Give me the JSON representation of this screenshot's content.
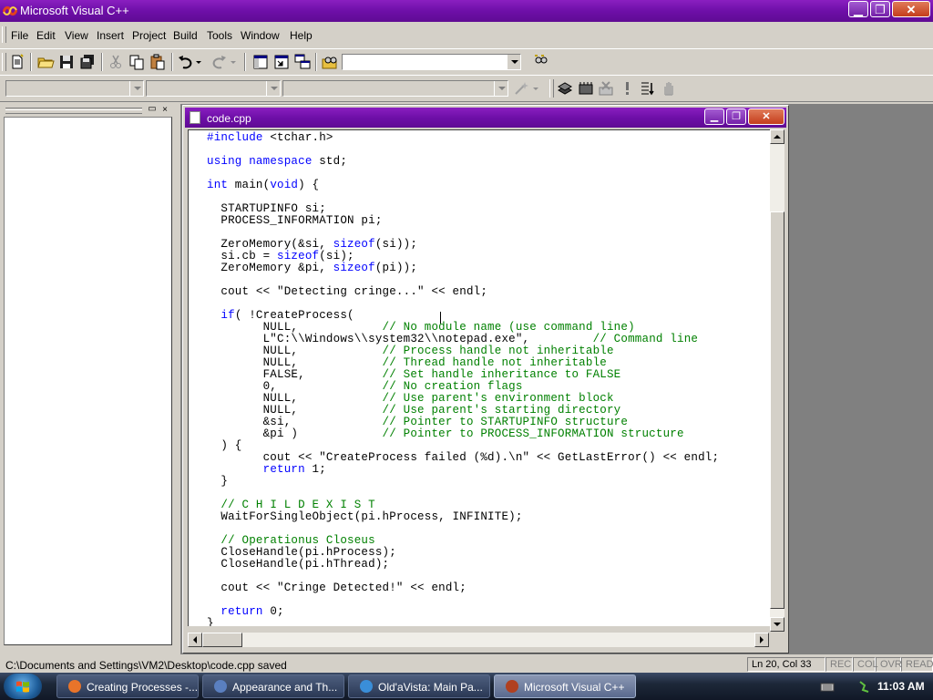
{
  "app": {
    "title": "Microsoft Visual C++"
  },
  "menu": [
    "File",
    "Edit",
    "View",
    "Insert",
    "Project",
    "Build",
    "Tools",
    "Window",
    "Help"
  ],
  "child": {
    "title": "code.cpp"
  },
  "code_lines": [
    "#include <tchar.h>",
    "",
    "using namespace std;",
    "",
    "int main(void) {",
    "",
    "  STARTUPINFO si;",
    "  PROCESS_INFORMATION pi;",
    "",
    "  ZeroMemory(&si, sizeof(si));",
    "  si.cb = sizeof(si);",
    "  ZeroMemory &pi, sizeof(pi));",
    "",
    "  cout << \"Detecting cringe...\" << endl;",
    "",
    "  if( !CreateProcess(",
    "        NULL,            // No module name (use command line)",
    "        L\"C:\\\\Windows\\\\system32\\\\notepad.exe\",         // Command line",
    "        NULL,            // Process handle not inheritable",
    "        NULL,            // Thread handle not inheritable",
    "        FALSE,           // Set handle inheritance to FALSE",
    "        0,               // No creation flags",
    "        NULL,            // Use parent's environment block",
    "        NULL,            // Use parent's starting directory",
    "        &si,             // Pointer to STARTUPINFO structure",
    "        &pi )            // Pointer to PROCESS_INFORMATION structure",
    "  ) {",
    "        cout << \"CreateProcess failed (%d).\\n\" << GetLastError() << endl;",
    "        return 1;",
    "  }",
    "",
    "  // C H I L D E X I S T",
    "  WaitForSingleObject(pi.hProcess, INFINITE);",
    "",
    "  // Operationus Closeus",
    "  CloseHandle(pi.hProcess);",
    "  CloseHandle(pi.hThread);",
    "",
    "  cout << \"Cringe Detected!\" << endl;",
    "",
    "  return 0;",
    "}"
  ],
  "status": {
    "message": "C:\\Documents and Settings\\VM2\\Desktop\\code.cpp saved",
    "position": "Ln 20, Col 33",
    "indicators": [
      "REC",
      "COL",
      "OVR",
      "READ"
    ]
  },
  "taskbar": {
    "tasks": [
      {
        "label": "Creating Processes -...",
        "icon": "firefox-icon",
        "color": "#e8742a"
      },
      {
        "label": "Appearance and Th...",
        "icon": "control-panel-icon",
        "color": "#5a7fc0"
      },
      {
        "label": "Old'aVista: Main Pa...",
        "icon": "ie-icon",
        "color": "#3a8ed8"
      },
      {
        "label": "Microsoft Visual C++",
        "icon": "visual-cpp-icon",
        "color": "#b04020",
        "active": true
      }
    ],
    "clock": "11:03 AM"
  }
}
